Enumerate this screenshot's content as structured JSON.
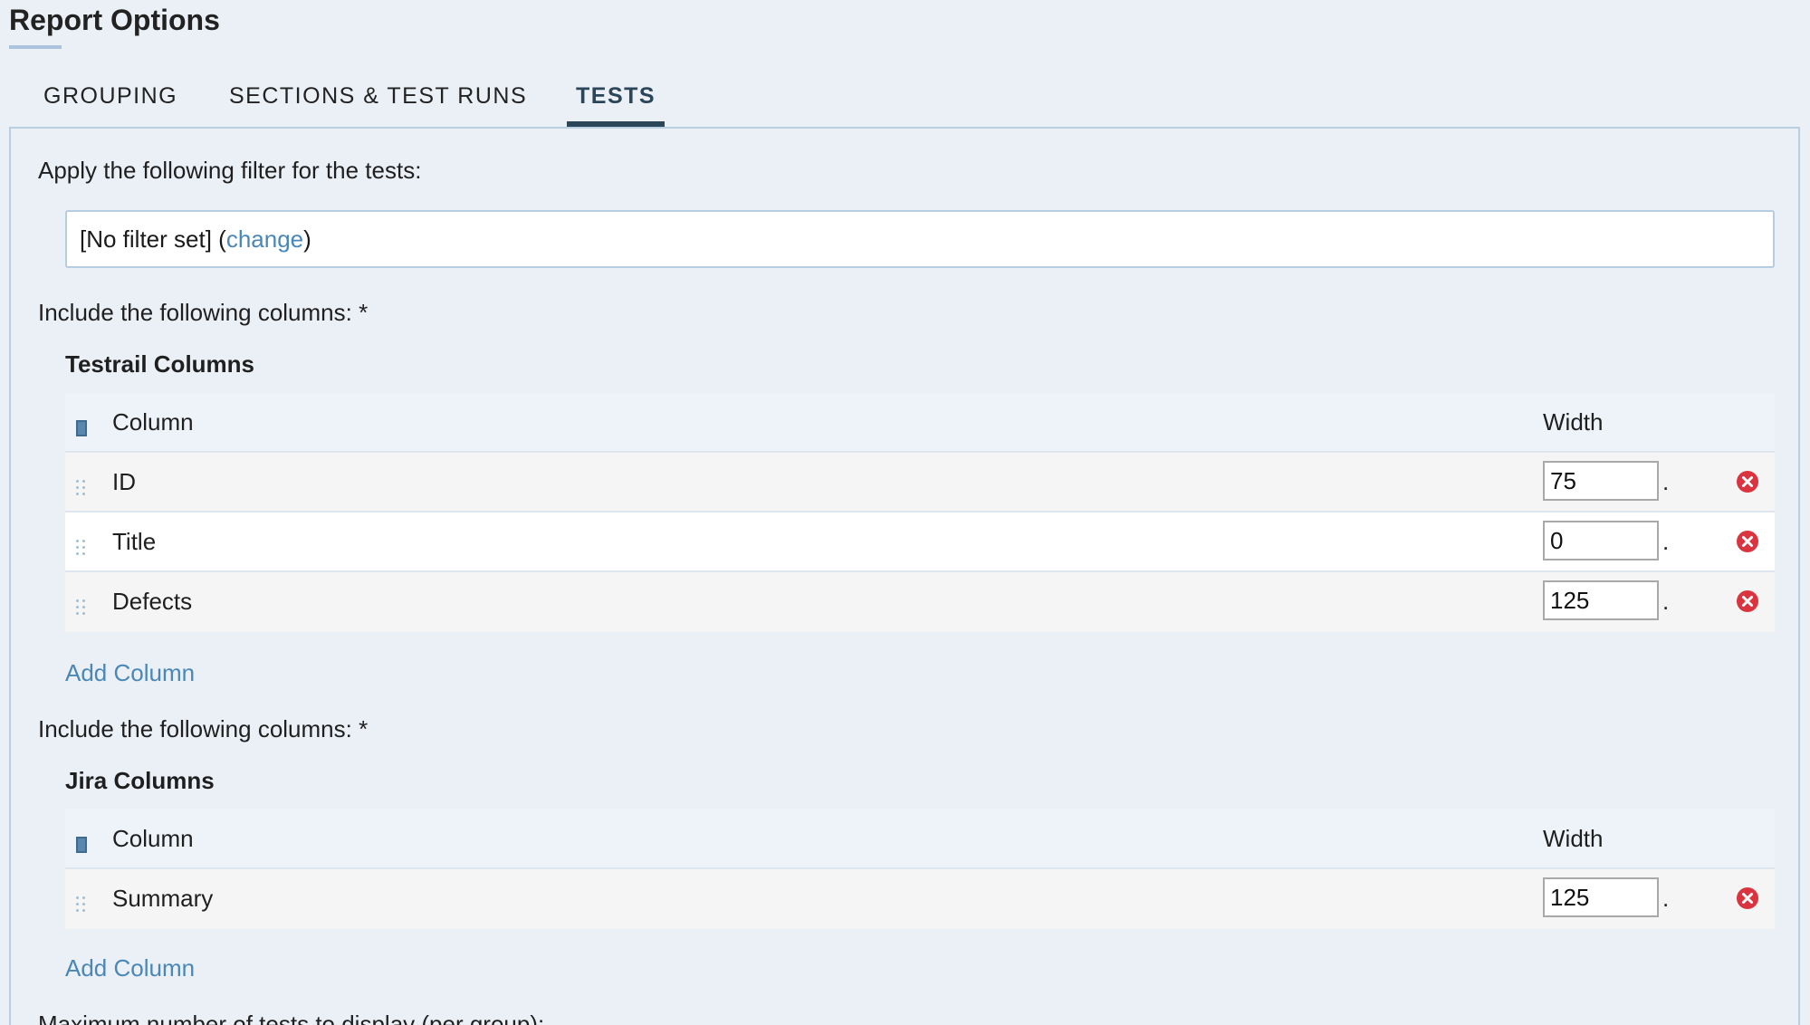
{
  "header": {
    "title": "Report Options"
  },
  "tabs": [
    {
      "label": "GROUPING",
      "active": false
    },
    {
      "label": "SECTIONS & TEST RUNS",
      "active": false
    },
    {
      "label": "TESTS",
      "active": true
    }
  ],
  "filter": {
    "label": "Apply the following filter for the tests:",
    "value_prefix": "[No filter set] (",
    "change_link": "change",
    "value_suffix": ")"
  },
  "testrail_section": {
    "include_label": "Include the following columns: *",
    "title": "Testrail Columns",
    "column_header": "Column",
    "width_header": "Width",
    "rows": [
      {
        "name": "ID",
        "width": "75"
      },
      {
        "name": "Title",
        "width": "0"
      },
      {
        "name": "Defects",
        "width": "125"
      }
    ],
    "add_column": "Add Column"
  },
  "jira_section": {
    "include_label": "Include the following columns: *",
    "title": "Jira Columns",
    "column_header": "Column",
    "width_header": "Width",
    "rows": [
      {
        "name": "Summary",
        "width": "125"
      }
    ],
    "add_column": "Add Column"
  },
  "max_tests": {
    "label": "Maximum number of tests to display (per group):"
  },
  "colors": {
    "background": "#ebf0f7",
    "link": "#4a87b8",
    "active_tab": "#2b4559",
    "remove_icon": "#d9343f"
  },
  "icons": {
    "row_handle": "drag-handle-icon",
    "remove": "remove-circle-x-icon",
    "select_all": "select-all-checkbox-icon"
  }
}
